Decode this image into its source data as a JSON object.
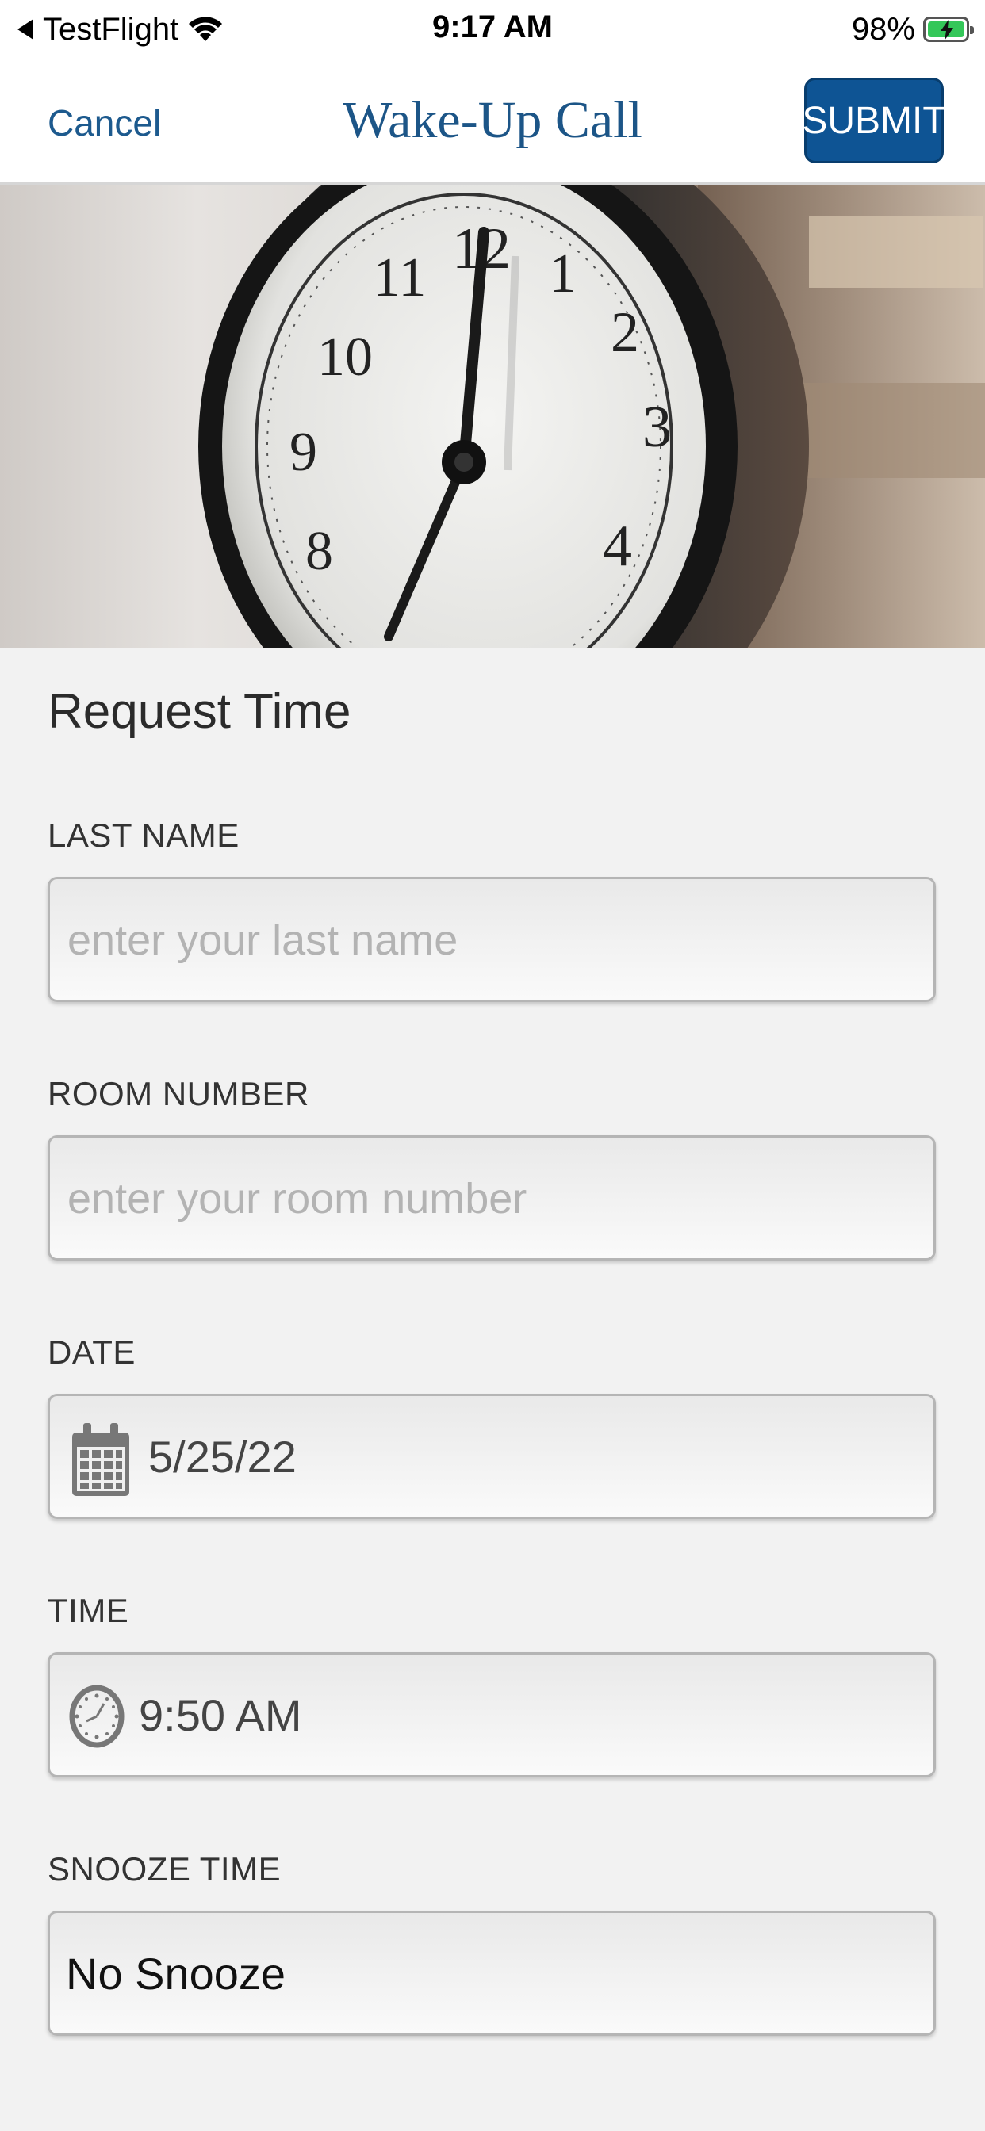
{
  "status_bar": {
    "back_app": "TestFlight",
    "time": "9:17 AM",
    "battery": "98%"
  },
  "nav": {
    "cancel_label": "Cancel",
    "title": "Wake-Up Call",
    "submit_label": "SUBMIT"
  },
  "hero": {
    "image": "alarm-clock-photo"
  },
  "form": {
    "title": "Request Time",
    "last_name": {
      "label": "LAST NAME",
      "value": "",
      "placeholder": "enter your last name"
    },
    "room_number": {
      "label": "ROOM NUMBER",
      "value": "",
      "placeholder": "enter your room number"
    },
    "date": {
      "label": "DATE",
      "value": "5/25/22",
      "icon": "calendar-icon"
    },
    "time": {
      "label": "TIME",
      "value": "9:50 AM",
      "icon": "clock-icon"
    },
    "snooze": {
      "label": "SNOOZE TIME",
      "value": "No Snooze"
    }
  },
  "colors": {
    "accent": "#0e5494",
    "title_blue": "#1c5587",
    "background": "#f2f2f2"
  }
}
